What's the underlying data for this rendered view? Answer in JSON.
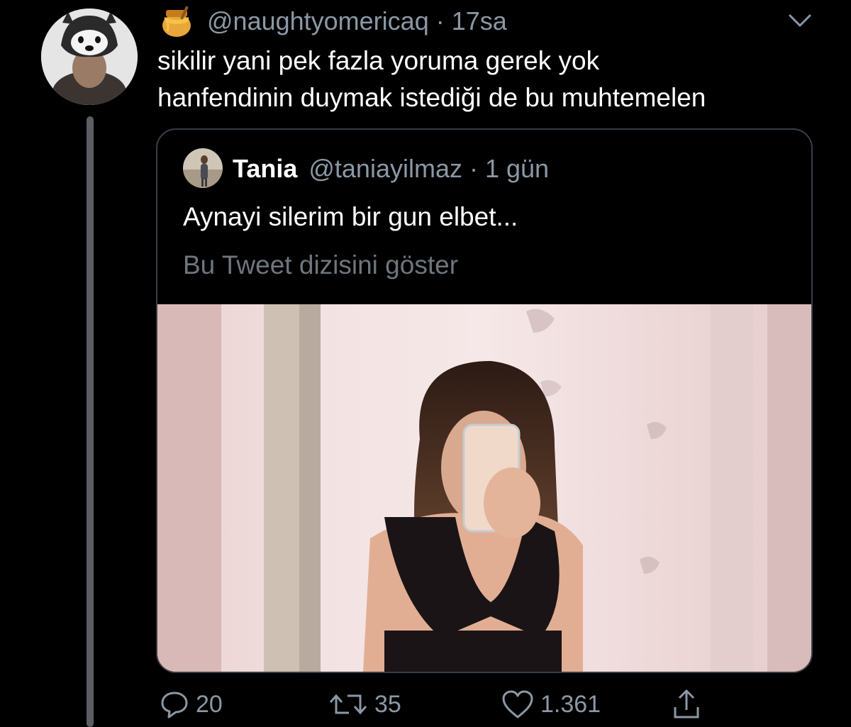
{
  "tweet": {
    "handle": "@naughtyomericaq",
    "separator": "·",
    "time": "17sa",
    "text_lines": [
      "sikilir yani pek fazla yoruma gerek yok",
      "hanfendinin duymak istediği de bu muhtemelen"
    ],
    "icons": {
      "name_emoji": "honey-pot-icon",
      "menu": "chevron-down-icon"
    }
  },
  "quoted_tweet": {
    "name": "Tania",
    "handle": "@taniayilmaz",
    "separator": "·",
    "time": "1 gün",
    "text": "Aynayi silerim bir gun elbet...",
    "thread_link": "Bu Tweet dizisini göster"
  },
  "actions": {
    "reply_count": "20",
    "retweet_count": "35",
    "like_count": "1.361",
    "icons": [
      "reply-icon",
      "retweet-icon",
      "like-icon",
      "share-icon"
    ]
  },
  "colors": {
    "background": "#000000",
    "text_primary": "#ffffff",
    "text_secondary": "#8b98a5",
    "border": "#3a3f44",
    "thread_line": "#5b5f63"
  }
}
